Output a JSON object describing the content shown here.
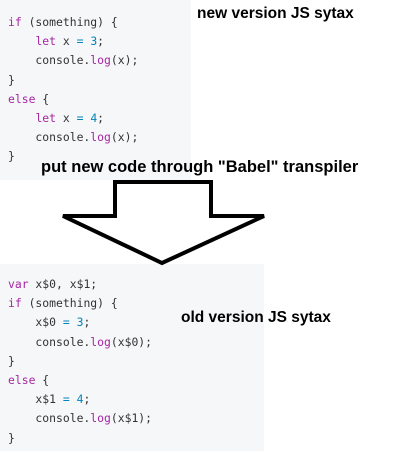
{
  "labels": {
    "new_version": "new version JS sytax",
    "transpile_note": "put new code through \"Babel\" transpiler",
    "old_version": "old version JS sytax"
  },
  "code_new": [
    [
      [
        "if",
        "kw"
      ],
      [
        " (something) {",
        "plain"
      ]
    ],
    [
      [
        "    ",
        "plain"
      ],
      [
        "let",
        "kw"
      ],
      [
        " x ",
        "plain"
      ],
      [
        "=",
        "op"
      ],
      [
        " ",
        "plain"
      ],
      [
        "3",
        "num"
      ],
      [
        ";",
        "plain"
      ]
    ],
    [
      [
        "    console.",
        "plain"
      ],
      [
        "log",
        "kw"
      ],
      [
        "(x);",
        "plain"
      ]
    ],
    [
      [
        "}",
        "plain"
      ]
    ],
    [
      [
        "else",
        "kw"
      ],
      [
        " {",
        "plain"
      ]
    ],
    [
      [
        "    ",
        "plain"
      ],
      [
        "let",
        "kw"
      ],
      [
        " x ",
        "plain"
      ],
      [
        "=",
        "op"
      ],
      [
        " ",
        "plain"
      ],
      [
        "4",
        "num"
      ],
      [
        ";",
        "plain"
      ]
    ],
    [
      [
        "    console.",
        "plain"
      ],
      [
        "log",
        "kw"
      ],
      [
        "(x);",
        "plain"
      ]
    ],
    [
      [
        "}",
        "plain"
      ]
    ]
  ],
  "code_old": [
    [
      [
        "var",
        "kw"
      ],
      [
        " x$0, x$1;",
        "plain"
      ]
    ],
    [
      [
        "if",
        "kw"
      ],
      [
        " (something) {",
        "plain"
      ]
    ],
    [
      [
        "    x$0 ",
        "plain"
      ],
      [
        "=",
        "op"
      ],
      [
        " ",
        "plain"
      ],
      [
        "3",
        "num"
      ],
      [
        ";",
        "plain"
      ]
    ],
    [
      [
        "    console.",
        "plain"
      ],
      [
        "log",
        "kw"
      ],
      [
        "(x$0);",
        "plain"
      ]
    ],
    [
      [
        "}",
        "plain"
      ]
    ],
    [
      [
        "else",
        "kw"
      ],
      [
        " {",
        "plain"
      ]
    ],
    [
      [
        "    x$1 ",
        "plain"
      ],
      [
        "=",
        "op"
      ],
      [
        " ",
        "plain"
      ],
      [
        "4",
        "num"
      ],
      [
        ";",
        "plain"
      ]
    ],
    [
      [
        "    console.",
        "plain"
      ],
      [
        "log",
        "kw"
      ],
      [
        "(x$1);",
        "plain"
      ]
    ],
    [
      [
        "}",
        "plain"
      ]
    ]
  ],
  "colors": {
    "code_background": "#f6f7f8",
    "keyword": "#a626a4",
    "operator": "#0184bb",
    "text": "#333333",
    "arrow_outline": "#000000",
    "arrow_fill": "#ffffff"
  },
  "arrow_direction": "down"
}
